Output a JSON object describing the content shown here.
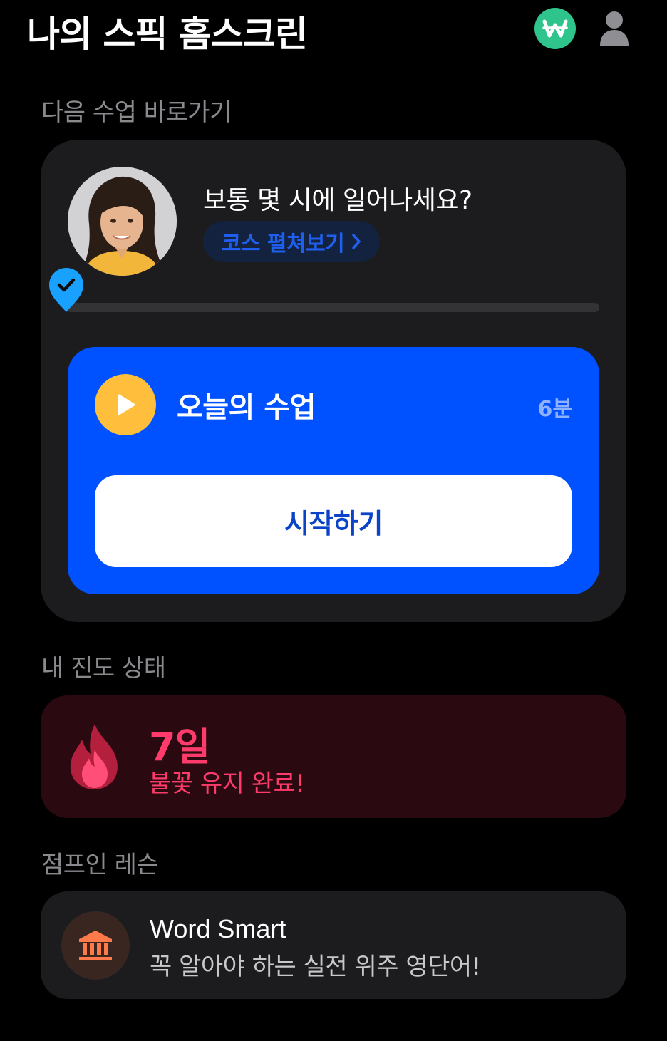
{
  "header": {
    "title": "나의 스픽 홈스크린",
    "won_icon": "won-currency-icon",
    "profile_icon": "user-profile-icon"
  },
  "next_lesson": {
    "section_label": "다음 수업 바로가기",
    "question": "보통 몇 시에 일어나세요?",
    "expand_label": "코스 펼쳐보기",
    "expand_icon": "chevron-right-icon",
    "progress_icon": "check-pin-icon",
    "progress_fraction": 0.0,
    "lesson": {
      "title": "오늘의 수업",
      "duration": "6분",
      "start_label": "시작하기",
      "play_icon": "play-icon"
    }
  },
  "progress": {
    "section_label": "내 진도 상태",
    "streak_days": "7일",
    "streak_message": "불꽃 유지 완료!",
    "icon": "fire-icon"
  },
  "jump_in": {
    "section_label": "점프인 레슨",
    "title": "Word Smart",
    "subtitle": "꼭 알아야 하는 실전 위주 영단어!",
    "icon": "bank-icon"
  },
  "colors": {
    "background": "#000000",
    "card": "#1c1c1e",
    "accent_blue": "#0051ff",
    "won_green": "#2ec48b",
    "play_yellow": "#ffbf3c",
    "streak_pink": "#ff3b6b",
    "streak_bg": "#2a0a10",
    "bank_orange": "#ff7a4a"
  }
}
